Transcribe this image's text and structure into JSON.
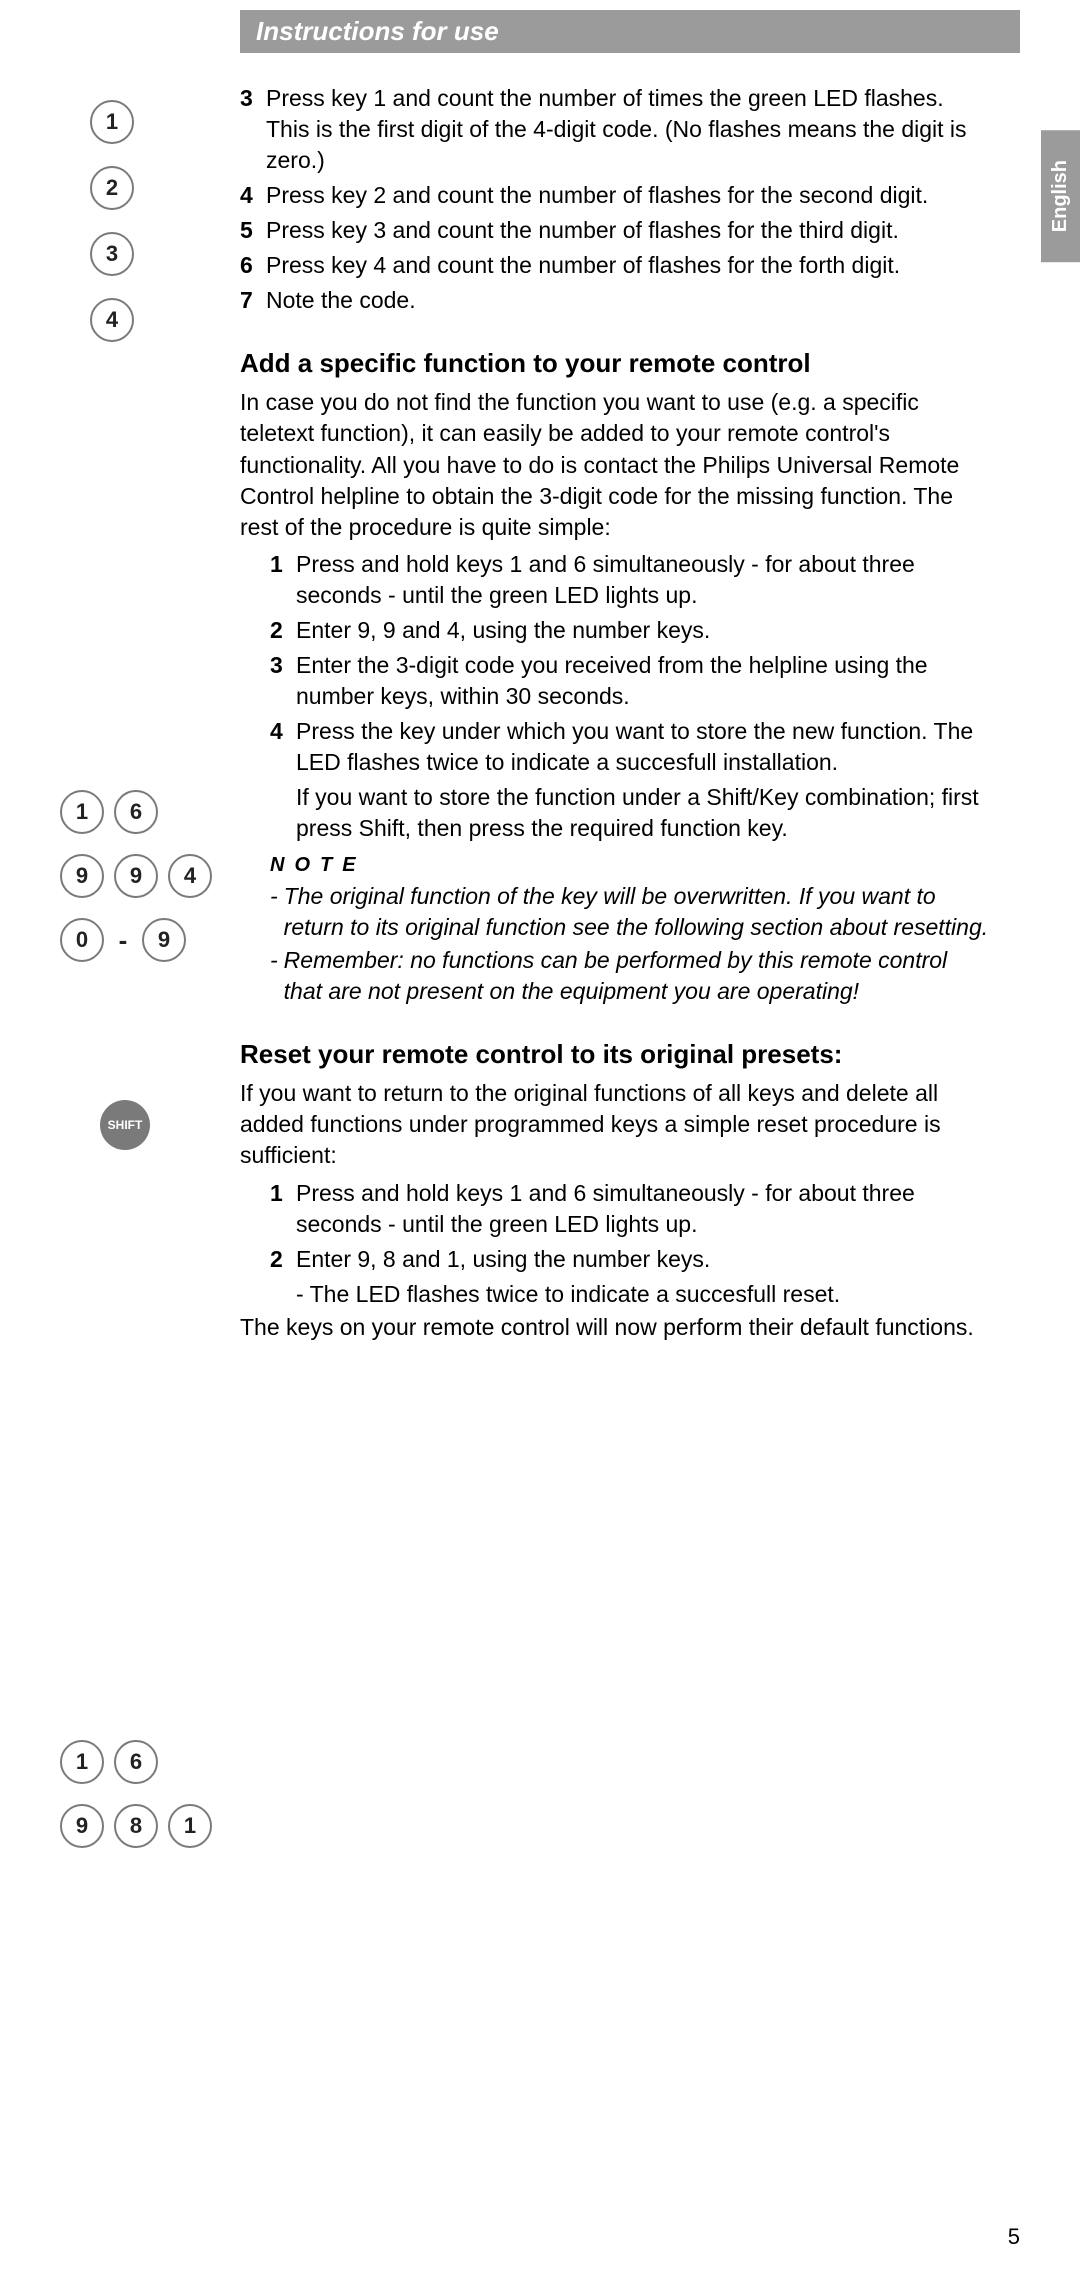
{
  "header": "Instructions for use",
  "lang": "English",
  "pageNum": "5",
  "topSteps": [
    {
      "n": "3",
      "t": "Press key 1 and count the number of times the green LED flashes. This is the first digit of the 4-digit code. (No flashes means the digit is zero.)"
    },
    {
      "n": "4",
      "t": "Press key 2 and count the number of flashes for the second digit."
    },
    {
      "n": "5",
      "t": "Press key 3 and count the number of flashes for the third digit."
    },
    {
      "n": "6",
      "t": "Press key 4 and count the number of flashes for the forth digit."
    },
    {
      "n": "7",
      "t": "Note the code."
    }
  ],
  "topKeys": [
    "1",
    "2",
    "3",
    "4"
  ],
  "addSection": {
    "title": "Add a specific function to your remote control",
    "intro": "In case you do not find the function you want to use (e.g. a specific teletext function), it can easily be added to your remote control's functionality. All you have to do is contact the Philips Universal Remote Control helpline to obtain the 3-digit code for the missing function. The rest of the procedure is quite simple:",
    "steps": [
      {
        "n": "1",
        "t": "Press and hold keys 1 and 6 simultaneously - for about three seconds - until the green LED lights up."
      },
      {
        "n": "2",
        "t": "Enter 9, 9 and 4, using the number keys."
      },
      {
        "n": "3",
        "t": "Enter the 3-digit code you received from the helpline using the number keys, within 30 seconds."
      },
      {
        "n": "4",
        "t": "Press the key under which you want to store the new function. The LED flashes twice to indicate a succesfull installation."
      }
    ],
    "shiftNote": "If you want to store the function under a Shift/Key combination; first press Shift, then press the required function key.",
    "noteHeading": "NOTE",
    "notes": [
      "The original function of the key will be overwritten. If you want to return to its original function see the following section about resetting.",
      "Remember: no functions can be performed by this remote control that are not present on the equipment you are operating!"
    ],
    "keys": {
      "row1": [
        "1",
        "6"
      ],
      "row2": [
        "9",
        "9",
        "4"
      ],
      "row3": [
        "0",
        "-",
        "9"
      ],
      "shift": "SHIFT"
    }
  },
  "resetSection": {
    "title": "Reset your remote control to its original presets:",
    "intro": "If you want to return to the original functions of all keys and delete all added functions under programmed keys a simple reset procedure is sufficient:",
    "steps": [
      {
        "n": "1",
        "t": "Press and hold keys 1 and 6 simultaneously - for about three seconds - until the green LED lights up."
      },
      {
        "n": "2",
        "t": "Enter 9, 8 and 1, using the number keys."
      }
    ],
    "confirm": "- The LED flashes twice to indicate a succesfull reset.",
    "outro": "The keys on your remote control will now perform their default functions.",
    "keys": {
      "row1": [
        "1",
        "6"
      ],
      "row2": [
        "9",
        "8",
        "1"
      ]
    }
  }
}
